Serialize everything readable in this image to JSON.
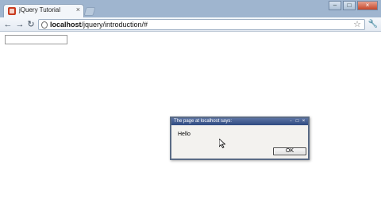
{
  "browser": {
    "tab": {
      "title": "jQuery Tutorial",
      "close_glyph": "×"
    },
    "window_controls": {
      "minimize": "–",
      "maximize": "□",
      "close": "×"
    },
    "toolbar": {
      "back_glyph": "←",
      "forward_glyph": "→",
      "reload_glyph": "↻",
      "url_host": "localhost",
      "url_path": "/jquery/introduction/#",
      "star_glyph": "☆",
      "wrench_glyph": "🔧"
    }
  },
  "page": {
    "text_input_value": ""
  },
  "dialog": {
    "title": "The page at localhost says:",
    "message": "Hello",
    "ok_label": "OK",
    "controls": {
      "minimize": "-",
      "maximize": "□",
      "close": "×"
    }
  },
  "colors": {
    "titlebar": "#9fb5cf",
    "dialog_titlebar": "#2f4a80",
    "favicon": "#c93a1f"
  }
}
